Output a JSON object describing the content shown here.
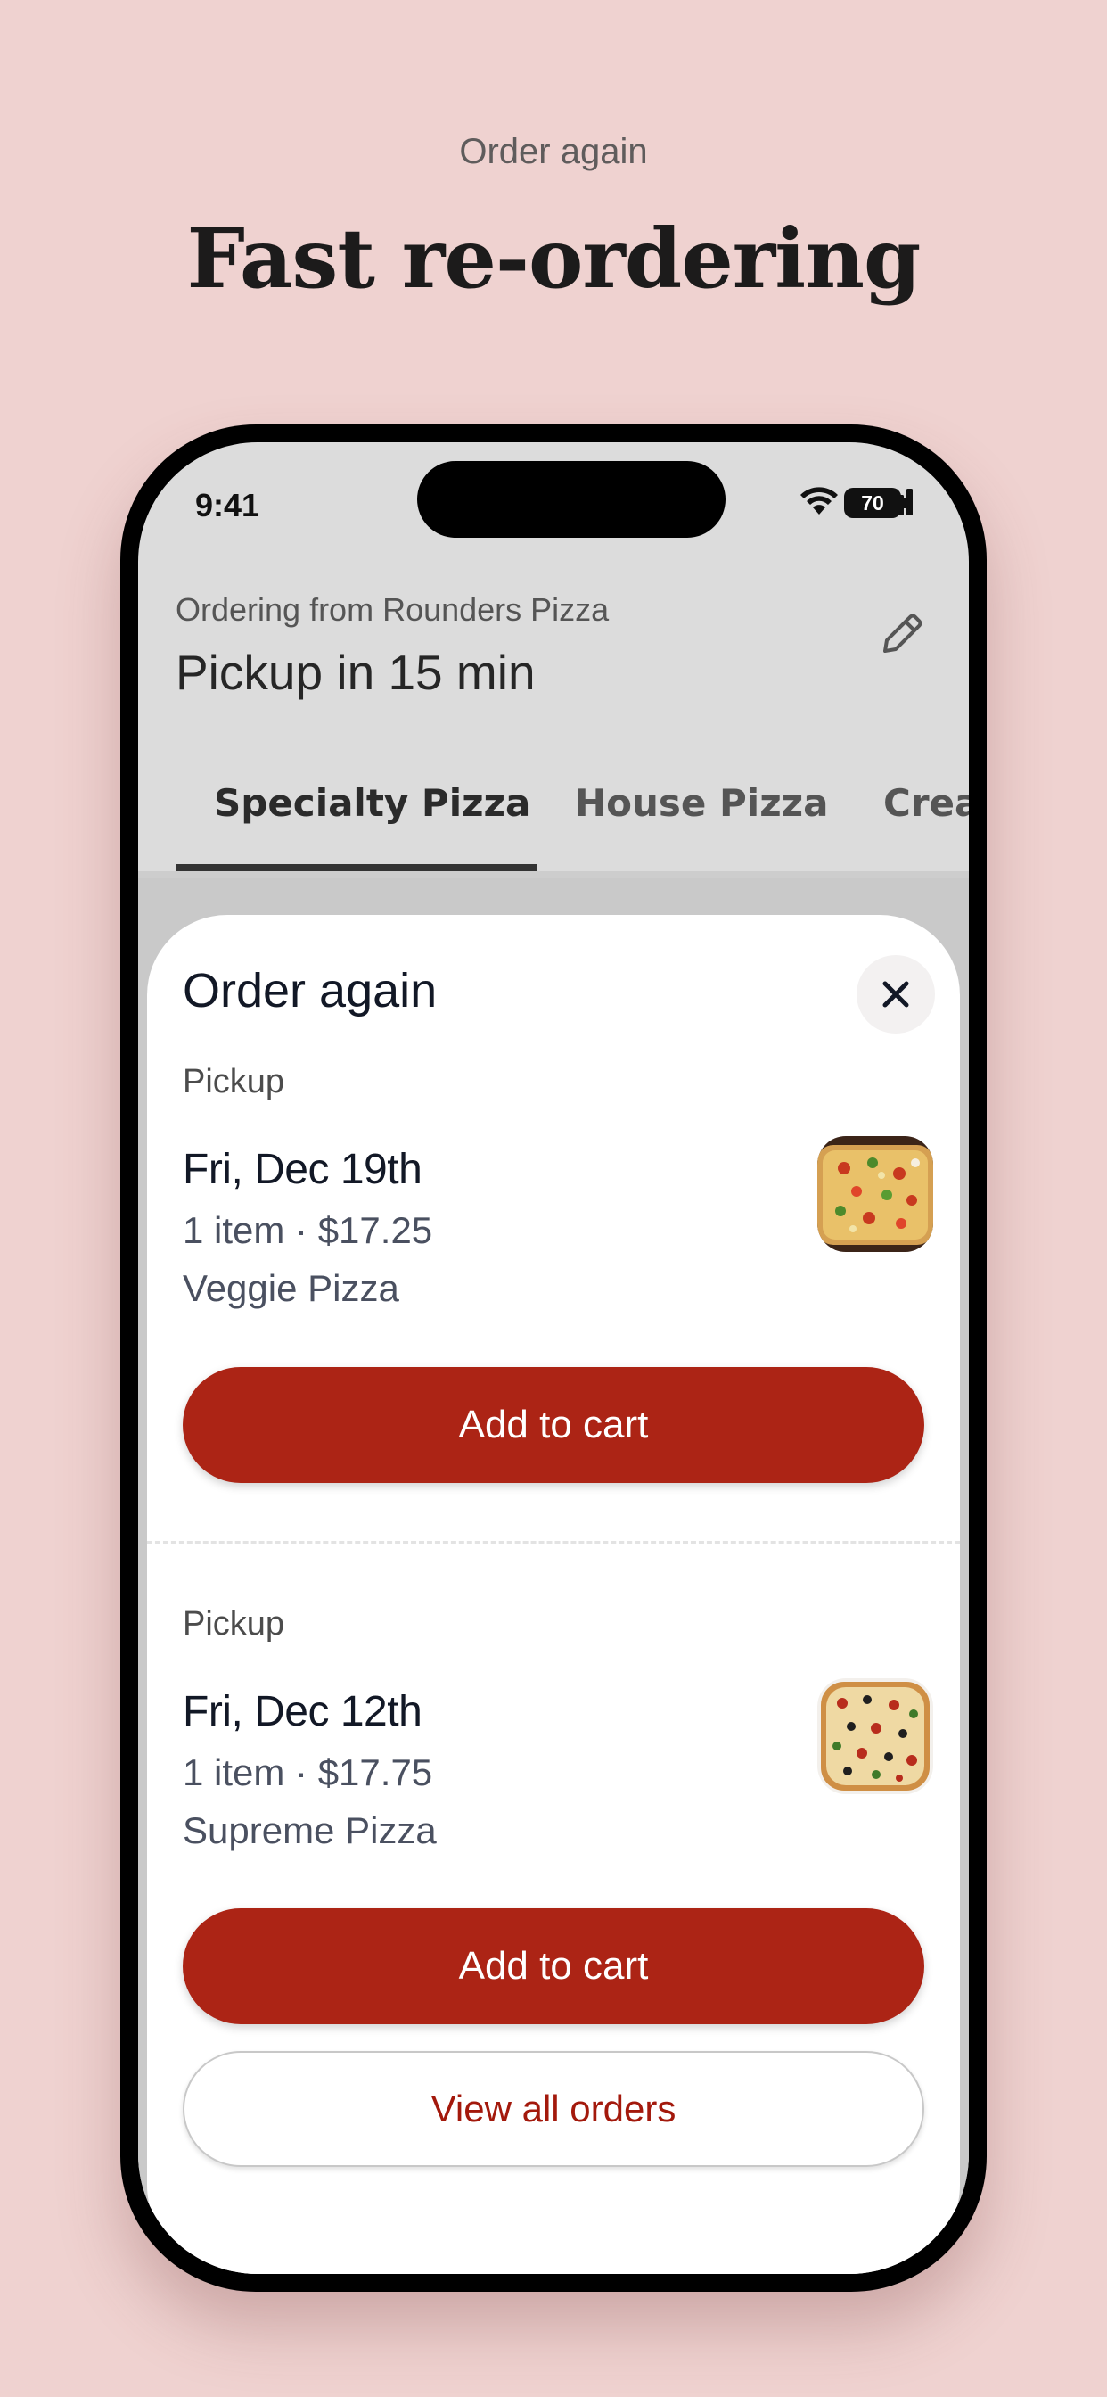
{
  "promo": {
    "eyebrow": "Order again",
    "headline": "Fast re-ordering"
  },
  "status_bar": {
    "time": "9:41",
    "battery": "70",
    "icons": [
      "signal-icon",
      "wifi-icon",
      "battery-icon"
    ]
  },
  "header": {
    "ordering_from": "Ordering from Rounders Pizza",
    "pickup_title": "Pickup in 15 min",
    "edit_icon": "pencil-icon"
  },
  "tabs": [
    {
      "label": "Specialty Pizza",
      "active": true
    },
    {
      "label": "House Pizza",
      "active": false
    },
    {
      "label": "Crea",
      "active": false
    }
  ],
  "sheet": {
    "title": "Order again",
    "close_icon": "close-icon",
    "orders": [
      {
        "type": "Pickup",
        "date": "Fri, Dec 19th",
        "meta": "1 item · $17.25",
        "item": "Veggie Pizza",
        "thumbnail": "veggie-pizza-image",
        "button": "Add to cart"
      },
      {
        "type": "Pickup",
        "date": "Fri, Dec 12th",
        "meta": "1 item · $17.75",
        "item": "Supreme Pizza",
        "thumbnail": "supreme-pizza-image",
        "button": "Add to cart"
      }
    ],
    "view_all": "View all orders"
  },
  "colors": {
    "background": "#efd2d0",
    "primary_button": "#ac2415",
    "link_text": "#a3190c"
  }
}
